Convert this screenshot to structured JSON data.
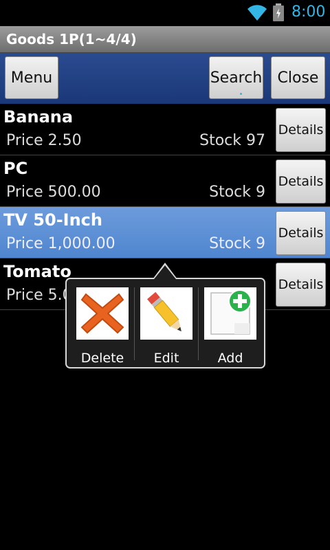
{
  "status": {
    "time": "8:00"
  },
  "header": {
    "title": "Goods 1P(1~4/4)"
  },
  "toolbar": {
    "menu": "Menu",
    "search": "Search",
    "close": "Close"
  },
  "items": [
    {
      "name": "Banana",
      "price": "Price 2.50",
      "stock": "Stock 97",
      "details": "Details"
    },
    {
      "name": "PC",
      "price": "Price 500.00",
      "stock": "Stock 9",
      "details": "Details"
    },
    {
      "name": "TV 50-Inch",
      "price": "Price 1,000.00",
      "stock": "Stock 9",
      "details": "Details"
    },
    {
      "name": "Tomato",
      "price": "Price 5.00",
      "stock": "",
      "details": "Details"
    }
  ],
  "popup": {
    "delete": "Delete",
    "edit": "Edit",
    "add": "Add"
  },
  "colors": {
    "accent": "#33b5e5",
    "selected_row": "#5b8fd6",
    "toolbar": "#213f83"
  }
}
